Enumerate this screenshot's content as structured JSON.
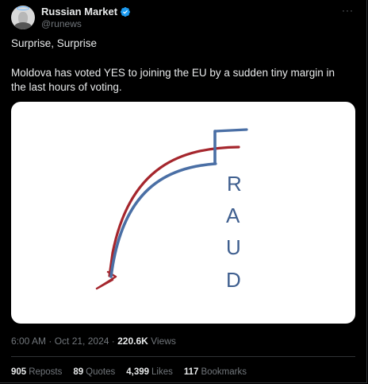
{
  "author": {
    "display_name": "Russian Market",
    "handle": "@runews",
    "verified": true,
    "avatar_icon": "avatar-portrait-with-halo"
  },
  "more_label": "···",
  "tweet": {
    "line1": "Surprise, Surprise",
    "line2": "Moldova has voted YES to joining the EU by a sudden tiny margin in the last hours of voting."
  },
  "image": {
    "letters": [
      "R",
      "A",
      "U",
      "D"
    ],
    "colors": {
      "red": "#a5262d",
      "blue": "#4a6fa5"
    }
  },
  "meta": {
    "time": "6:00 AM",
    "separator1": " · ",
    "date": "Oct 21, 2024",
    "separator2": " · ",
    "views": "220.6K",
    "views_label": " Views"
  },
  "stats": [
    {
      "num": "905",
      "label": "Reposts"
    },
    {
      "num": "89",
      "label": "Quotes"
    },
    {
      "num": "4,399",
      "label": "Likes"
    },
    {
      "num": "117",
      "label": "Bookmarks"
    }
  ],
  "colors": {
    "background": "#000000",
    "text": "#e7e9ea",
    "muted": "#71767b",
    "verified": "#1d9bf0"
  }
}
